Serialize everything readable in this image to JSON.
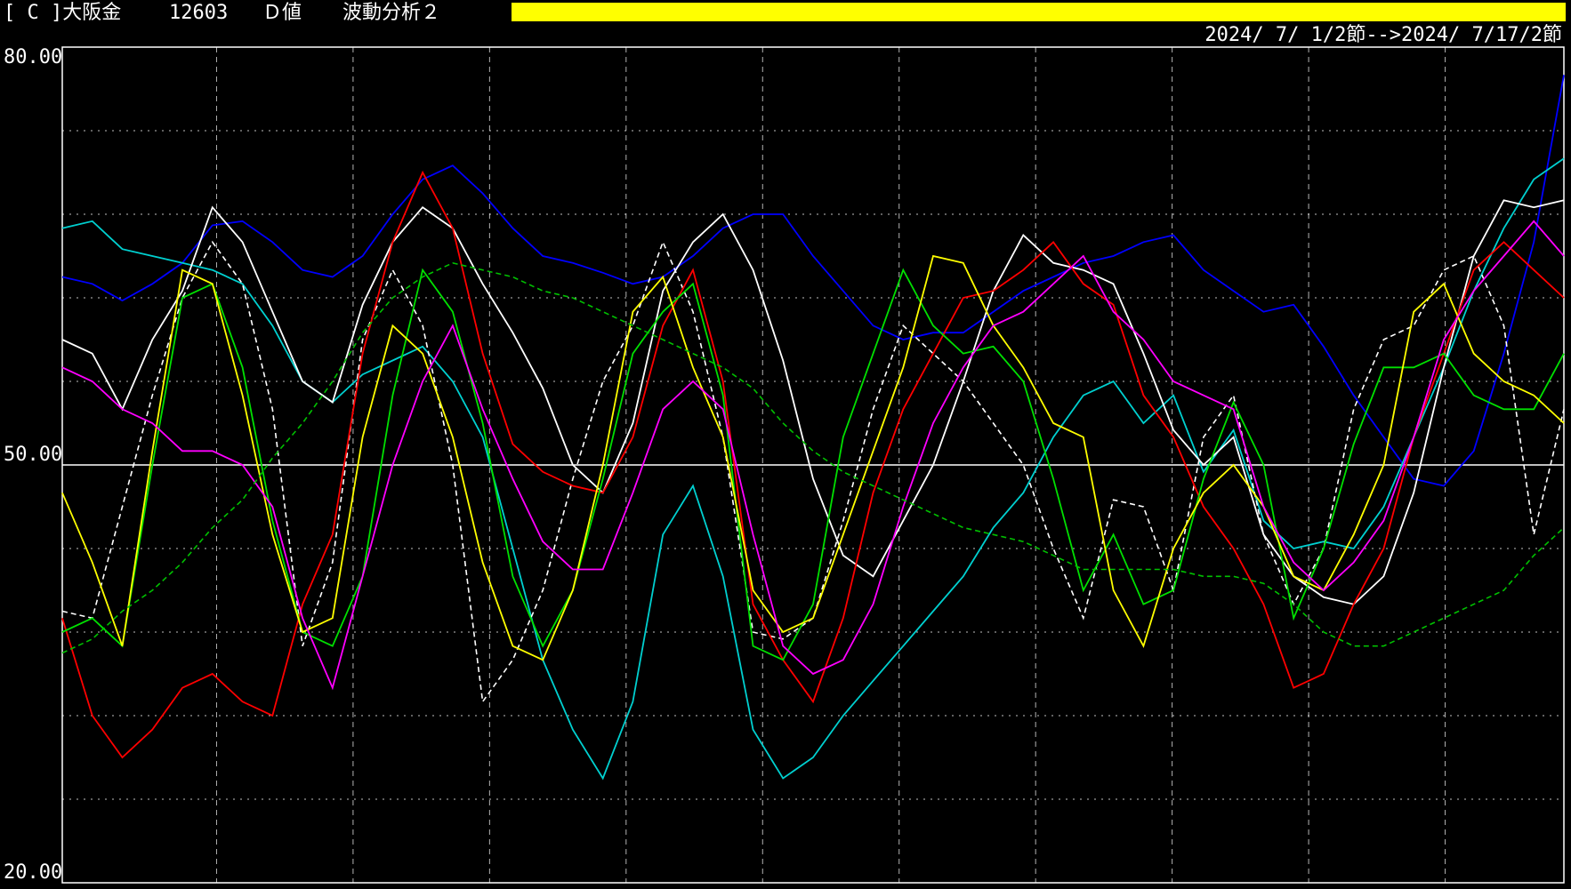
{
  "header": {
    "code_label": "[ C ]大阪金",
    "code_number": "12603",
    "value_type": "Ｄ値",
    "analysis_name": "波動分析２",
    "date_range": "2024/ 7/ 1/2節-->2024/ 7/17/2節"
  },
  "colors": {
    "background": "#000000",
    "header_bar": "#ffff00",
    "grid": "#ffffff",
    "axis": "#ffffff"
  },
  "chart_data": {
    "type": "line",
    "title": "",
    "xlabel": "",
    "ylabel": "",
    "ylim": [
      20,
      80
    ],
    "yticks": [
      {
        "value": 80,
        "label": "80.00"
      },
      {
        "value": 50,
        "label": "50.00"
      },
      {
        "value": 20,
        "label": "20.00"
      }
    ],
    "y_minor_gridlines": [
      20,
      26,
      32,
      38,
      44,
      56,
      62,
      68,
      74
    ],
    "y_midline": 50,
    "x_vertical_gridlines": 10,
    "grid": true,
    "points_per_series": 51,
    "series": [
      {
        "color": "#0000ff",
        "dashed": false,
        "values": [
          63.5,
          63,
          61.8,
          63,
          64.5,
          67.2,
          67.5,
          66,
          64,
          63.5,
          65,
          68,
          70.5,
          71.5,
          69.5,
          67,
          65,
          64.5,
          63.8,
          63,
          63.5,
          65,
          67,
          68,
          68,
          65,
          62.5,
          60,
          59,
          59.5,
          59.5,
          61,
          62.5,
          63.5,
          64.5,
          65,
          66,
          66.5,
          64,
          62.5,
          61,
          61.5,
          58.5,
          55,
          52,
          49,
          48.5,
          51,
          58,
          66,
          78
        ]
      },
      {
        "color": "#00c8c8",
        "dashed": false,
        "values": null,
        "values_note": "not used"
      },
      {
        "color": "#00d0d0",
        "dashed": false,
        "values": [
          67,
          67.5,
          65.5,
          65,
          64.5,
          64,
          63,
          60,
          56,
          54.5,
          56.5,
          57.5,
          58.5,
          56,
          52,
          44,
          36,
          31,
          27.5,
          33,
          45,
          48.5,
          42,
          31,
          27.5,
          29,
          32,
          34.5,
          37,
          39.5,
          42,
          45.5,
          48,
          52,
          55,
          56,
          53,
          55,
          49.5,
          52.5,
          46,
          44,
          44.5,
          44,
          47,
          52,
          57,
          62.5,
          67,
          70.5,
          72
        ]
      },
      {
        "color": "#ffffff",
        "dashed": false,
        "values": [
          59,
          58,
          54,
          59,
          62.5,
          68.5,
          66,
          61,
          56,
          54.5,
          61.5,
          66,
          68.5,
          67,
          63,
          59.5,
          55.5,
          50,
          48,
          53,
          62.5,
          66,
          68,
          64,
          57.5,
          49,
          43.5,
          42,
          46,
          50,
          56,
          62.5,
          66.5,
          64.5,
          64,
          63,
          58,
          52.5,
          50,
          52,
          45,
          42,
          40.5,
          40,
          42,
          48,
          57,
          65,
          69,
          68.5,
          69
        ]
      },
      {
        "color": "#ffffff",
        "dashed": true,
        "values": [
          39.5,
          39,
          47,
          55,
          62,
          66,
          63,
          54,
          37,
          43,
          59,
          64,
          60,
          50,
          33,
          36,
          41,
          49,
          56,
          60,
          66,
          61,
          52,
          38,
          37.5,
          39,
          46,
          54,
          60,
          58,
          56,
          53,
          50,
          44,
          39,
          47.5,
          47,
          41,
          52,
          55,
          45,
          40,
          44,
          54,
          59,
          60,
          64,
          65,
          60,
          45,
          54
        ]
      },
      {
        "color": "#ff0000",
        "dashed": false,
        "values": [
          39,
          32,
          29,
          31,
          34,
          35,
          33,
          32,
          40,
          45,
          58,
          66,
          71,
          67,
          58,
          51.5,
          49.5,
          48.5,
          48,
          52,
          60,
          64,
          56,
          40,
          36,
          33,
          39,
          48,
          54,
          58,
          62,
          62.5,
          64,
          66,
          63,
          61.5,
          55,
          52,
          47,
          44,
          40,
          34,
          35,
          40,
          44,
          52,
          58,
          64,
          66,
          64,
          62
        ]
      },
      {
        "color": "#00e000",
        "dashed": false,
        "values": [
          38,
          39,
          37,
          50,
          62,
          63,
          57,
          46,
          38,
          37,
          42,
          55,
          64,
          61,
          53,
          42,
          37,
          41,
          49,
          58,
          61,
          63,
          55,
          37,
          36,
          40,
          52,
          58,
          64,
          60,
          58,
          58.5,
          56,
          49,
          41,
          45,
          40,
          41,
          49,
          54.5,
          50,
          39,
          44,
          51.5,
          57,
          57,
          58,
          55,
          54,
          54,
          58
        ]
      },
      {
        "color": "#ffff00",
        "dashed": false,
        "values": [
          48,
          43,
          37,
          51,
          64,
          63,
          55,
          45,
          38,
          39,
          52,
          60,
          58,
          52,
          43,
          37,
          36,
          41,
          50,
          61,
          63.5,
          57,
          52,
          41,
          38,
          39,
          45,
          51,
          57,
          65,
          64.5,
          60,
          57,
          53,
          52,
          41,
          37,
          44,
          48,
          50,
          47,
          42,
          41,
          45,
          50,
          61,
          63,
          58,
          56,
          55,
          53
        ]
      },
      {
        "color": "#ff00ff",
        "dashed": false,
        "values": [
          57,
          56,
          54,
          53,
          51,
          51,
          50,
          47,
          39,
          34,
          42,
          50,
          56,
          60,
          54,
          49,
          44.5,
          42.5,
          42.5,
          48,
          54,
          56,
          54,
          45,
          37,
          35,
          36,
          40,
          47,
          53,
          57,
          60,
          61,
          63,
          65,
          61,
          59,
          56,
          55,
          54,
          47,
          43,
          41,
          43,
          46,
          52,
          59,
          62.5,
          65,
          67.5,
          65
        ]
      },
      {
        "color": "#00c000",
        "dashed": true,
        "values": [
          36.5,
          37.5,
          39.5,
          41,
          43,
          45.5,
          47.5,
          50.5,
          53,
          56,
          59.5,
          62,
          63.5,
          64.5,
          64,
          63.5,
          62.5,
          62,
          61,
          60,
          59,
          58,
          57,
          55.5,
          53,
          51,
          49.5,
          48.5,
          47.5,
          46.5,
          45.5,
          45,
          44.5,
          43.5,
          42.5,
          42.5,
          42.5,
          42.5,
          42,
          42,
          41.5,
          40,
          38,
          37,
          37,
          38,
          39,
          40,
          41,
          43.5,
          45.5
        ]
      }
    ]
  }
}
